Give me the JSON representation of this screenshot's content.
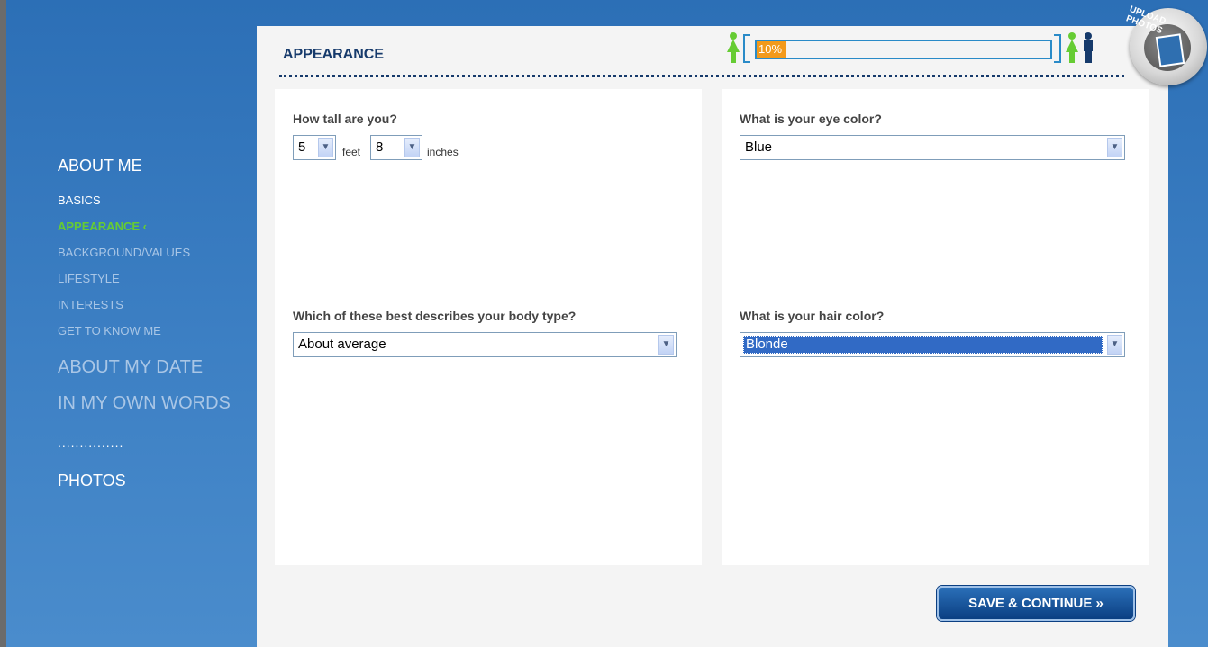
{
  "sidebar": {
    "about_me": "ABOUT ME",
    "items": [
      {
        "label": "BASICS"
      },
      {
        "label": "APPEARANCE"
      },
      {
        "label": "BACKGROUND/VALUES"
      },
      {
        "label": "LIFESTYLE"
      },
      {
        "label": "INTERESTS"
      },
      {
        "label": "GET TO KNOW ME"
      }
    ],
    "active_marker": "‹",
    "about_my_date": "ABOUT MY DATE",
    "in_my_own_words": "IN MY OWN WORDS",
    "separator": "...............",
    "photos": "PHOTOS"
  },
  "header": {
    "title": "APPEARANCE",
    "progress_label": "10%",
    "progress_value": 0.1,
    "upload_label": "UPLOAD PHOTOS"
  },
  "form": {
    "height_question": "How tall are you?",
    "height_feet": "5",
    "feet_unit": "feet",
    "height_inches": "8",
    "inches_unit": "inches",
    "eye_question": "What is your eye color?",
    "eye_value": "Blue",
    "body_question": "Which of these best describes your body type?",
    "body_value": "About average",
    "hair_question": "What is your hair color?",
    "hair_value": "Blonde"
  },
  "footer": {
    "save_label": "SAVE & CONTINUE »"
  },
  "colors": {
    "background": "#2c6fb6",
    "active_nav": "#66cc33",
    "title": "#163a6b",
    "progress_fill": "#f39a1b",
    "button": "#0b3f82"
  },
  "icons": [
    "single-person-icon",
    "couple-icon",
    "chevron-down-icon",
    "upload-photo-icon"
  ]
}
